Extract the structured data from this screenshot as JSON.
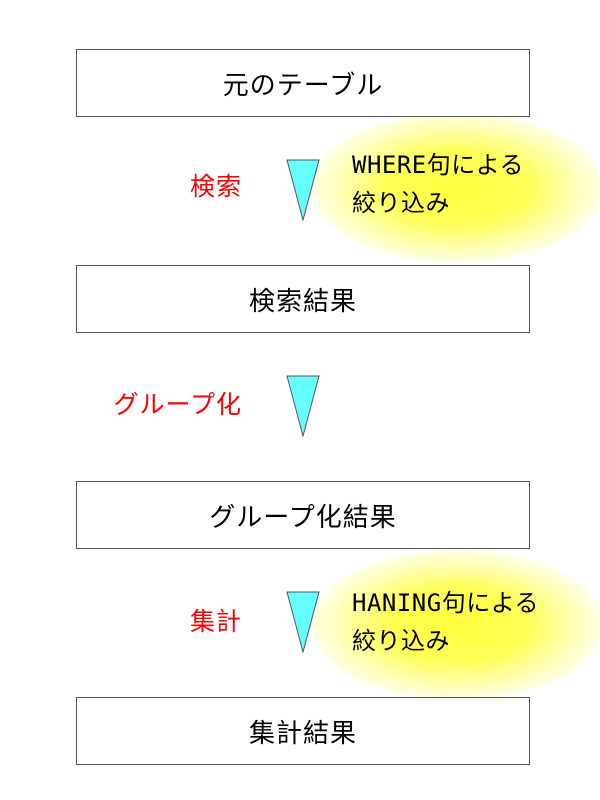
{
  "stages": [
    {
      "label": "元のテーブル"
    },
    {
      "label": "検索結果"
    },
    {
      "label": "グループ化結果"
    },
    {
      "label": "集計結果"
    }
  ],
  "operations": [
    {
      "label": "検索"
    },
    {
      "label": "グループ化"
    },
    {
      "label": "集計"
    }
  ],
  "notes": [
    {
      "line1": "WHERE句による",
      "line2": "絞り込み"
    },
    {
      "line1": "HANING句による",
      "line2": "絞り込み"
    }
  ],
  "colors": {
    "operation_text": "#ff0000",
    "arrow_fill": "#66ffff",
    "arrow_stroke": "#555555",
    "highlight": "#ffff40"
  },
  "icons": {
    "arrow": "down-triangle-arrow-icon"
  }
}
